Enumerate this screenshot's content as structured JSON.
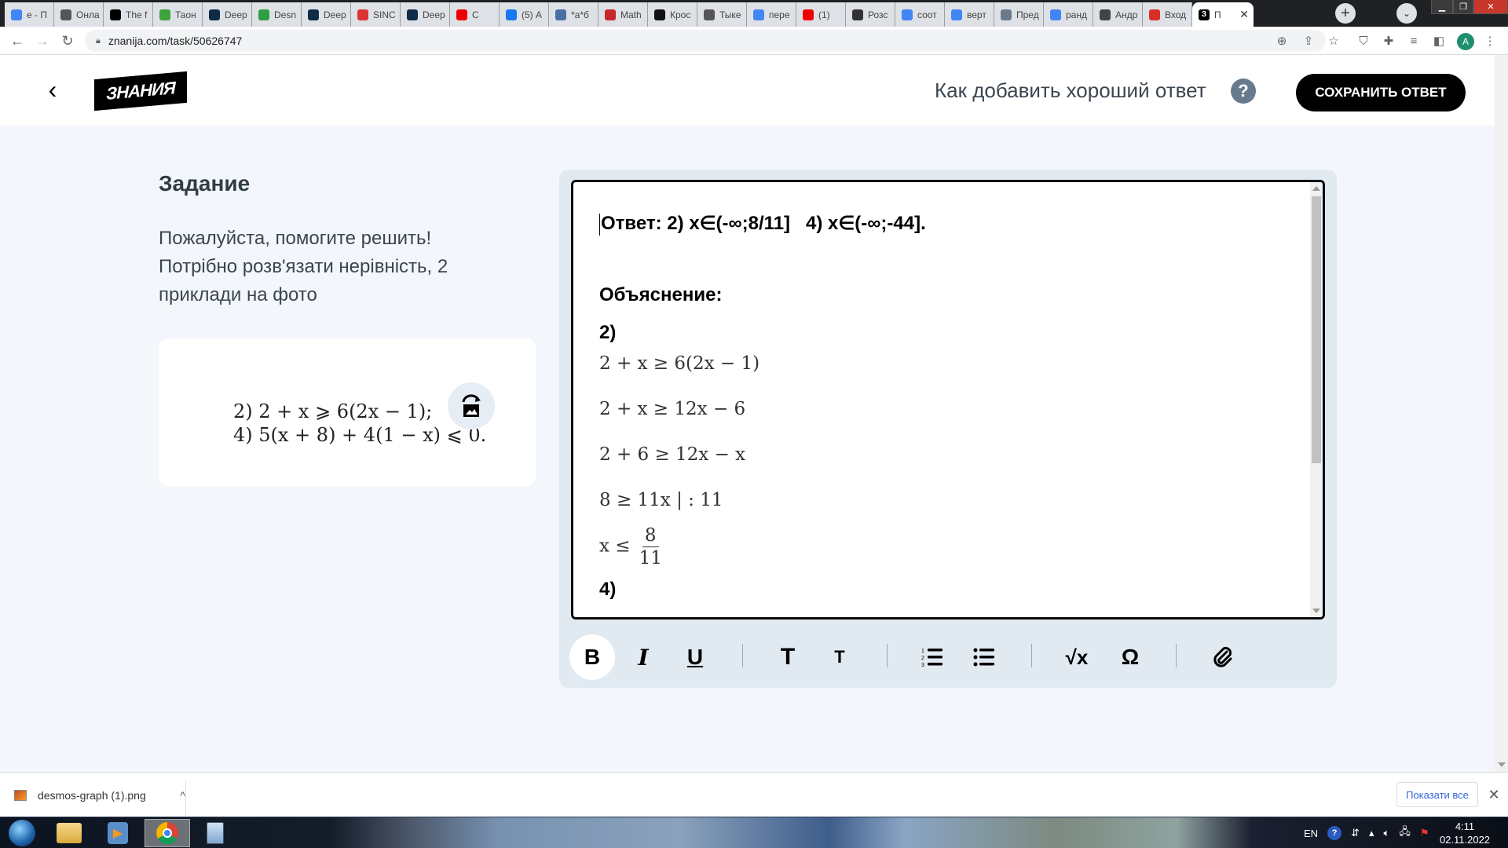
{
  "browser": {
    "tabs": [
      {
        "label": "e - П",
        "icon": "google-icon",
        "color": "#4285f4"
      },
      {
        "label": "Онла",
        "icon": "math-root-icon",
        "color": "#555555"
      },
      {
        "label": "The f",
        "icon": "bold-b-icon",
        "color": "#000000"
      },
      {
        "label": "Таон",
        "icon": "spiral-icon",
        "color": "#3ea33e"
      },
      {
        "label": "Deep",
        "icon": "deepl-icon",
        "color": "#0f2b46"
      },
      {
        "label": "Desn",
        "icon": "desmos-icon",
        "color": "#2f9e44"
      },
      {
        "label": "Deep",
        "icon": "deepl-icon",
        "color": "#0f2b46"
      },
      {
        "label": "SINC",
        "icon": "thermometer-icon",
        "color": "#d33"
      },
      {
        "label": "Deep",
        "icon": "deepl-icon",
        "color": "#0f2b46"
      },
      {
        "label": "С",
        "icon": "youtube-icon",
        "color": "#e00"
      },
      {
        "label": "(5) А",
        "icon": "facebook-icon",
        "color": "#1877f2"
      },
      {
        "label": "*a*б",
        "icon": "magnifier-icon",
        "color": "#4a6fa5"
      },
      {
        "label": "Math",
        "icon": "mathway-icon",
        "color": "#c62828"
      },
      {
        "label": "Крос",
        "icon": "crossword-icon",
        "color": "#111111"
      },
      {
        "label": "Тыке",
        "icon": "globe-icon",
        "color": "#555555"
      },
      {
        "label": "пере",
        "icon": "google-icon",
        "color": "#4285f4"
      },
      {
        "label": "(1)",
        "icon": "youtube-icon",
        "color": "#e00"
      },
      {
        "label": "Розс",
        "icon": "face-icon",
        "color": "#333333"
      },
      {
        "label": "соот",
        "icon": "google-icon",
        "color": "#4285f4"
      },
      {
        "label": "верт",
        "icon": "google-icon",
        "color": "#4285f4"
      },
      {
        "label": "Пред",
        "icon": "prism-icon",
        "color": "#6b7b8c"
      },
      {
        "label": "ранд",
        "icon": "google-icon",
        "color": "#4285f4"
      },
      {
        "label": "Андр",
        "icon": "u-icon",
        "color": "#444444"
      },
      {
        "label": "Вход",
        "icon": "gmail-icon",
        "color": "#d93025"
      }
    ],
    "active_tab": {
      "label": "П",
      "icon": "znanija-icon"
    },
    "url": "znanija.com/task/50626747",
    "profile_initial": "A"
  },
  "header": {
    "logo": "ЗНАНИЯ",
    "how_to_link": "Как добавить хороший ответ",
    "help_icon": "?",
    "save_button": "СОХРАНИТЬ ОТВЕТ"
  },
  "task": {
    "title": "Задание",
    "text": "Пожалуйста, помогите решить! Потрібно розв'язати нерівність, 2 приклади на фото",
    "image_lines": [
      "2) 2 + x ⩾ 6(2x − 1);",
      "4) 5(x + 8) + 4(1 − x) ⩽ 0."
    ]
  },
  "editor": {
    "answer_line": "Ответ: 2) x∈(-∞;8/11]   4) x∈(-∞;-44].",
    "explanation_label": "Объяснение:",
    "part2_label": "2)",
    "steps": [
      "2 + x ≥ 6(2x − 1)",
      "2 + x ≥ 12x − 6",
      "2 + 6 ≥ 12x − x",
      "8 ≥ 11x | : 11"
    ],
    "final_lhs": "x ≤",
    "final_num": "8",
    "final_den": "11",
    "part4_label": "4)"
  },
  "toolbar": {
    "bold": "B",
    "italic": "I",
    "underline": "U",
    "heading_large": "T",
    "heading_small": "T",
    "ordered_list": "ordered-list",
    "bullet_list": "bullet-list",
    "formula": "√x",
    "symbol": "Ω",
    "attach": "attach"
  },
  "downloads": {
    "file": "desmos-graph (1).png",
    "show_all": "Показати все"
  },
  "taskbar": {
    "language": "EN",
    "time": "4:11",
    "date": "02.11.2022"
  }
}
